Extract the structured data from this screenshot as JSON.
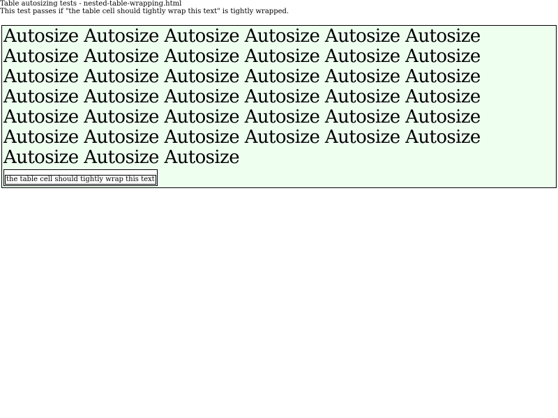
{
  "header": {
    "title": "Table autosizing tests - nested-table-wrapping.html",
    "description": "This test passes if \"the table cell should tightly wrap this text\" is tightly wrapped."
  },
  "outer_table": {
    "background_color": "#eefff0",
    "autosize_word": "Autosize",
    "autosize_count": 39
  },
  "inner_table": {
    "cell_text": "the table cell should tightly wrap this text"
  }
}
